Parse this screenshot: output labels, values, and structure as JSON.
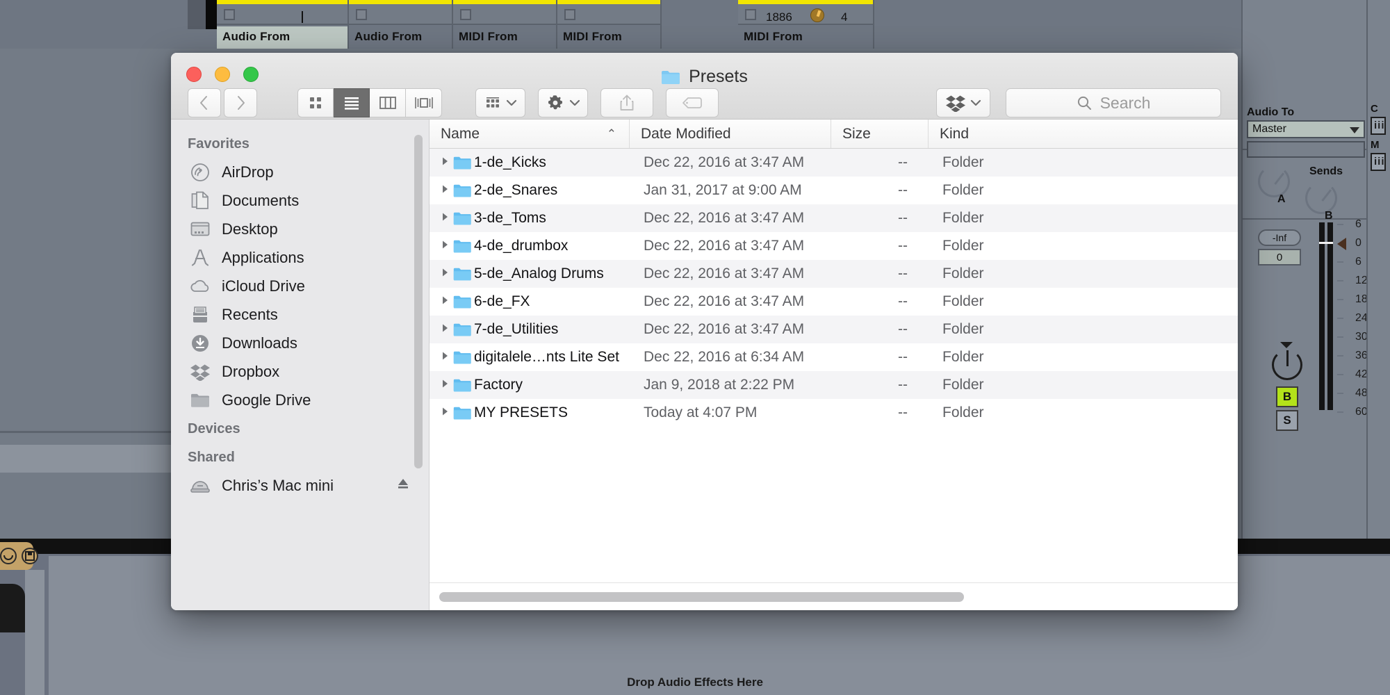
{
  "finder": {
    "title": "Presets",
    "title_icon": "folder-icon",
    "traffic_lights": [
      {
        "name": "close",
        "color": "#fc605c"
      },
      {
        "name": "minimize",
        "color": "#fdbc40"
      },
      {
        "name": "maximize",
        "color": "#34c749"
      }
    ],
    "toolbar": {
      "back": "back-icon",
      "forward": "forward-icon",
      "view_modes": [
        {
          "name": "icon-view",
          "active": false
        },
        {
          "name": "list-view",
          "active": true
        },
        {
          "name": "column-view",
          "active": false
        },
        {
          "name": "gallery-view",
          "active": false
        }
      ],
      "arrange": "arrange-icon",
      "action": "gear-icon",
      "share": "share-icon",
      "tags": "tag-icon",
      "dropbox": "dropbox-icon"
    },
    "search": {
      "placeholder": "Search",
      "value": "",
      "icon": "search-icon"
    },
    "sidebar": {
      "sections": [
        {
          "header": "Favorites",
          "items": [
            {
              "label": "AirDrop",
              "icon": "airdrop-icon"
            },
            {
              "label": "Documents",
              "icon": "documents-icon"
            },
            {
              "label": "Desktop",
              "icon": "desktop-icon"
            },
            {
              "label": "Applications",
              "icon": "applications-icon"
            },
            {
              "label": "iCloud Drive",
              "icon": "icloud-icon"
            },
            {
              "label": "Recents",
              "icon": "recents-icon"
            },
            {
              "label": "Downloads",
              "icon": "downloads-icon"
            },
            {
              "label": "Dropbox",
              "icon": "dropbox-icon"
            },
            {
              "label": "Google Drive",
              "icon": "folder-icon"
            }
          ]
        },
        {
          "header": "Devices",
          "items": []
        },
        {
          "header": "Shared",
          "items": [
            {
              "label": "Chris’s Mac mini",
              "icon": "server-icon",
              "eject": true
            }
          ]
        }
      ]
    },
    "columns": [
      {
        "label": "Name",
        "sorted": true,
        "sort_arrow": "⌃"
      },
      {
        "label": "Date Modified"
      },
      {
        "label": "Size"
      },
      {
        "label": "Kind"
      }
    ],
    "files": [
      {
        "name": "1-de_Kicks",
        "date": "Dec 22, 2016 at 3:47 AM",
        "size": "--",
        "kind": "Folder"
      },
      {
        "name": "2-de_Snares",
        "date": "Jan 31, 2017 at 9:00 AM",
        "size": "--",
        "kind": "Folder"
      },
      {
        "name": "3-de_Toms",
        "date": "Dec 22, 2016 at 3:47 AM",
        "size": "--",
        "kind": "Folder"
      },
      {
        "name": "4-de_drumbox",
        "date": "Dec 22, 2016 at 3:47 AM",
        "size": "--",
        "kind": "Folder"
      },
      {
        "name": "5-de_Analog Drums",
        "date": "Dec 22, 2016 at 3:47 AM",
        "size": "--",
        "kind": "Folder"
      },
      {
        "name": "6-de_FX",
        "date": "Dec 22, 2016 at 3:47 AM",
        "size": "--",
        "kind": "Folder"
      },
      {
        "name": "7-de_Utilities",
        "date": "Dec 22, 2016 at 3:47 AM",
        "size": "--",
        "kind": "Folder"
      },
      {
        "name": "digitalele…nts Lite Set",
        "date": "Dec 22, 2016 at 6:34 AM",
        "size": "--",
        "kind": "Folder"
      },
      {
        "name": "Factory",
        "date": "Jan 9, 2018 at 2:22 PM",
        "size": "--",
        "kind": "Folder"
      },
      {
        "name": "MY PRESETS",
        "date": "Today at 4:07 PM",
        "size": "--",
        "kind": "Folder"
      }
    ]
  },
  "daw": {
    "tracks": [
      {
        "label": "Audio From",
        "selected": true,
        "caret": true,
        "mic": false
      },
      {
        "label": "Audio From",
        "selected": false,
        "caret": false,
        "mic": true
      },
      {
        "label": "MIDI From",
        "selected": false,
        "caret": false,
        "mic": false
      },
      {
        "label": "MIDI From",
        "selected": false,
        "caret": false,
        "mic": false
      },
      {
        "label": "MIDI From",
        "selected": false,
        "caret": false,
        "mic": false,
        "clip_number": "1886",
        "clip_count": "4"
      }
    ],
    "mixer": {
      "audio_to_label": "Audio To",
      "audio_to_value": "Master",
      "sends_label": "Sends",
      "send_a": "A",
      "send_b": "B",
      "volume_value": "-Inf",
      "pan_value": "0",
      "button_b": "B",
      "button_s": "S",
      "scale": [
        "6",
        "0",
        "6",
        "12",
        "18",
        "24",
        "30",
        "36",
        "42",
        "48",
        "60"
      ]
    },
    "edge_labels": [
      "C",
      "M"
    ],
    "edge_icons": [
      "iii",
      "iii"
    ],
    "drop_hint": "Drop Audio Effects Here"
  }
}
